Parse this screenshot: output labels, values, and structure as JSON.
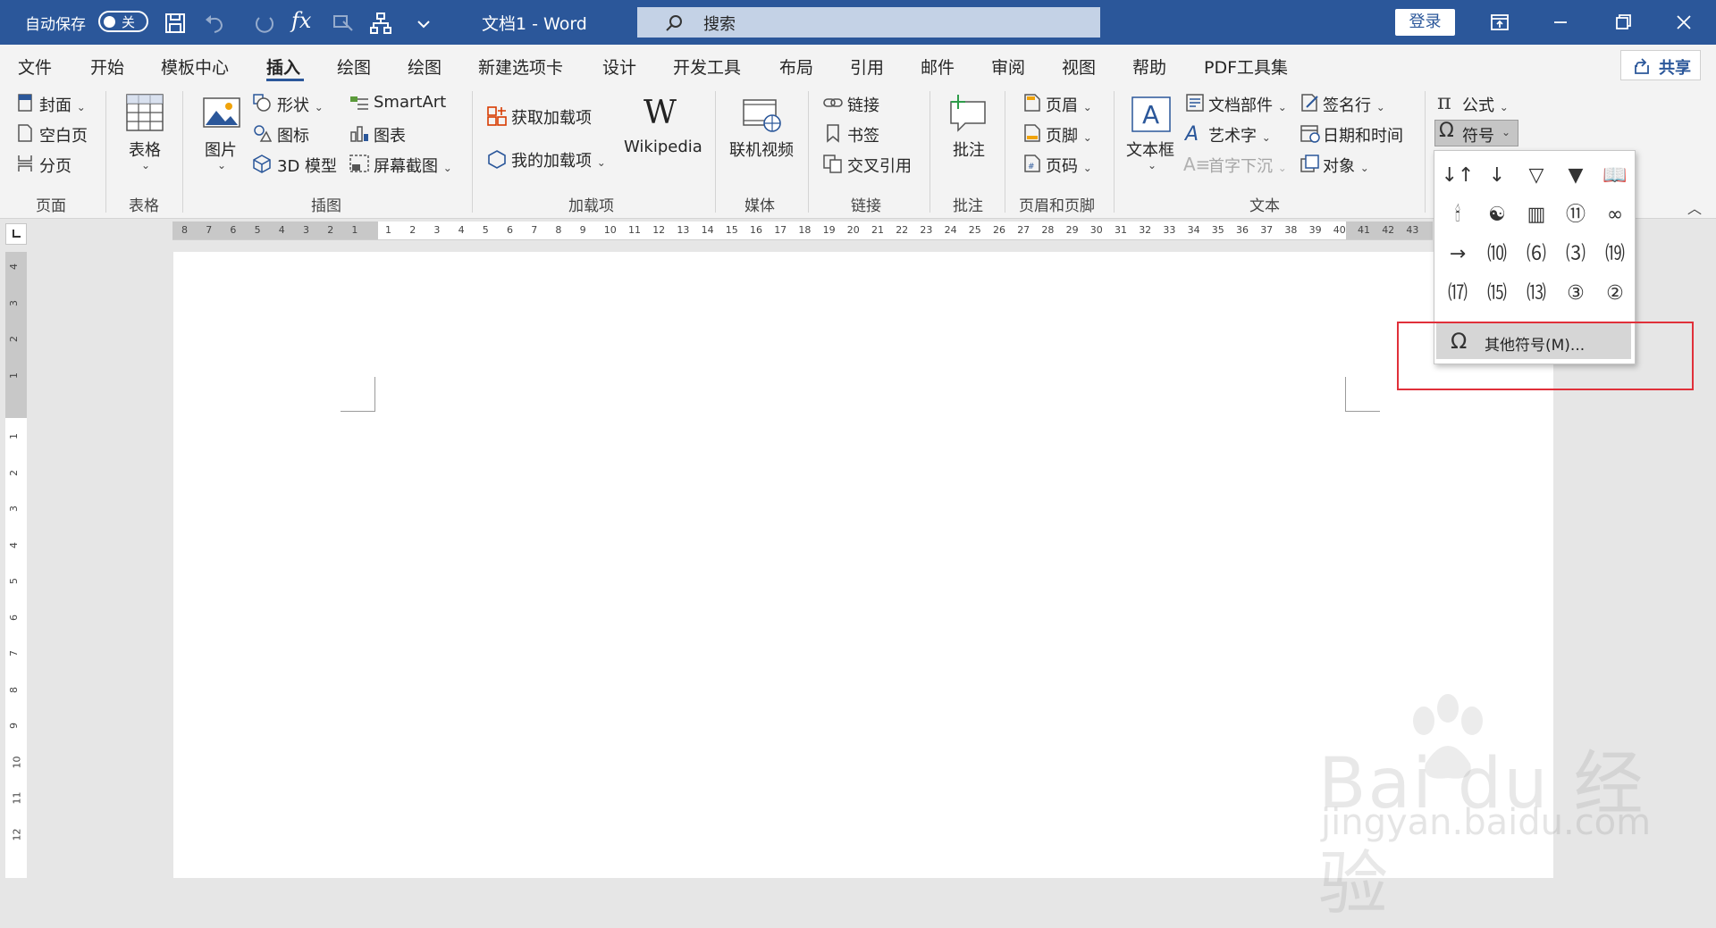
{
  "titlebar": {
    "autosave_label": "自动保存",
    "autosave_state": "关",
    "doc_title": "文档1  -  Word",
    "search_text": "搜索",
    "login_label": "登录"
  },
  "tabs": [
    {
      "label": "文件"
    },
    {
      "label": "开始"
    },
    {
      "label": "模板中心"
    },
    {
      "label": "插入"
    },
    {
      "label": "绘图"
    },
    {
      "label": "绘图"
    },
    {
      "label": "新建选项卡"
    },
    {
      "label": "设计"
    },
    {
      "label": "开发工具"
    },
    {
      "label": "布局"
    },
    {
      "label": "引用"
    },
    {
      "label": "邮件"
    },
    {
      "label": "审阅"
    },
    {
      "label": "视图"
    },
    {
      "label": "帮助"
    },
    {
      "label": "PDF工具集"
    }
  ],
  "share_label": "共享",
  "ribbon": {
    "pages": {
      "cover": "封面",
      "blank": "空白页",
      "break": "分页",
      "group": "页面"
    },
    "tables": {
      "table": "表格",
      "group": "表格"
    },
    "illustrations": {
      "picture": "图片",
      "shapes": "形状",
      "icons": "图标",
      "model3d": "3D 模型",
      "smartart": "SmartArt",
      "chart": "图表",
      "screenshot": "屏幕截图",
      "group": "插图"
    },
    "addins": {
      "get": "获取加载项",
      "mine": "我的加载项",
      "wikipedia": "Wikipedia",
      "group": "加载项"
    },
    "media": {
      "video": "联机视频",
      "group": "媒体"
    },
    "links": {
      "link": "链接",
      "bookmark": "书签",
      "crossref": "交叉引用",
      "group": "链接"
    },
    "comments": {
      "comment": "批注",
      "group": "批注"
    },
    "headerfooter": {
      "header": "页眉",
      "footer": "页脚",
      "pagenum": "页码",
      "group": "页眉和页脚"
    },
    "text": {
      "textbox": "文本框",
      "quickparts": "文档部件",
      "wordart": "艺术字",
      "dropcap": "首字下沉",
      "sigline": "签名行",
      "datetime": "日期和时间",
      "object": "对象",
      "group": "文本"
    },
    "symbols": {
      "equation": "公式",
      "symbol": "符号"
    }
  },
  "symbol_menu": {
    "symbols": [
      "↓↑",
      "↓",
      "▽",
      "▼",
      "📖",
      "🕯",
      "☯",
      "▥",
      "⑪",
      "∞",
      "→",
      "⑽",
      "⑹",
      "⑶",
      "⒆",
      "⒄",
      "⒂",
      "⒀",
      "③",
      "②"
    ],
    "more_label": "其他符号(M)..."
  },
  "hruler_numbers": [
    "8",
    "7",
    "6",
    "5",
    "4",
    "3",
    "2",
    "1",
    "1",
    "2",
    "3",
    "4",
    "5",
    "6",
    "7",
    "8",
    "9",
    "10",
    "11",
    "12",
    "13",
    "14",
    "15",
    "16",
    "17",
    "18",
    "19",
    "20",
    "21",
    "22",
    "23",
    "24",
    "25",
    "26",
    "27",
    "28",
    "29",
    "30",
    "31",
    "32",
    "33",
    "34",
    "35",
    "36",
    "37",
    "38",
    "39",
    "40",
    "41",
    "42",
    "43"
  ],
  "vruler_numbers": [
    "4",
    "3",
    "2",
    "1",
    "1",
    "2",
    "3",
    "4",
    "5",
    "6",
    "7",
    "8",
    "9",
    "10",
    "11",
    "12"
  ],
  "watermark": {
    "line1": "Bai du 经验",
    "line2": "jingyan.baidu.com"
  }
}
